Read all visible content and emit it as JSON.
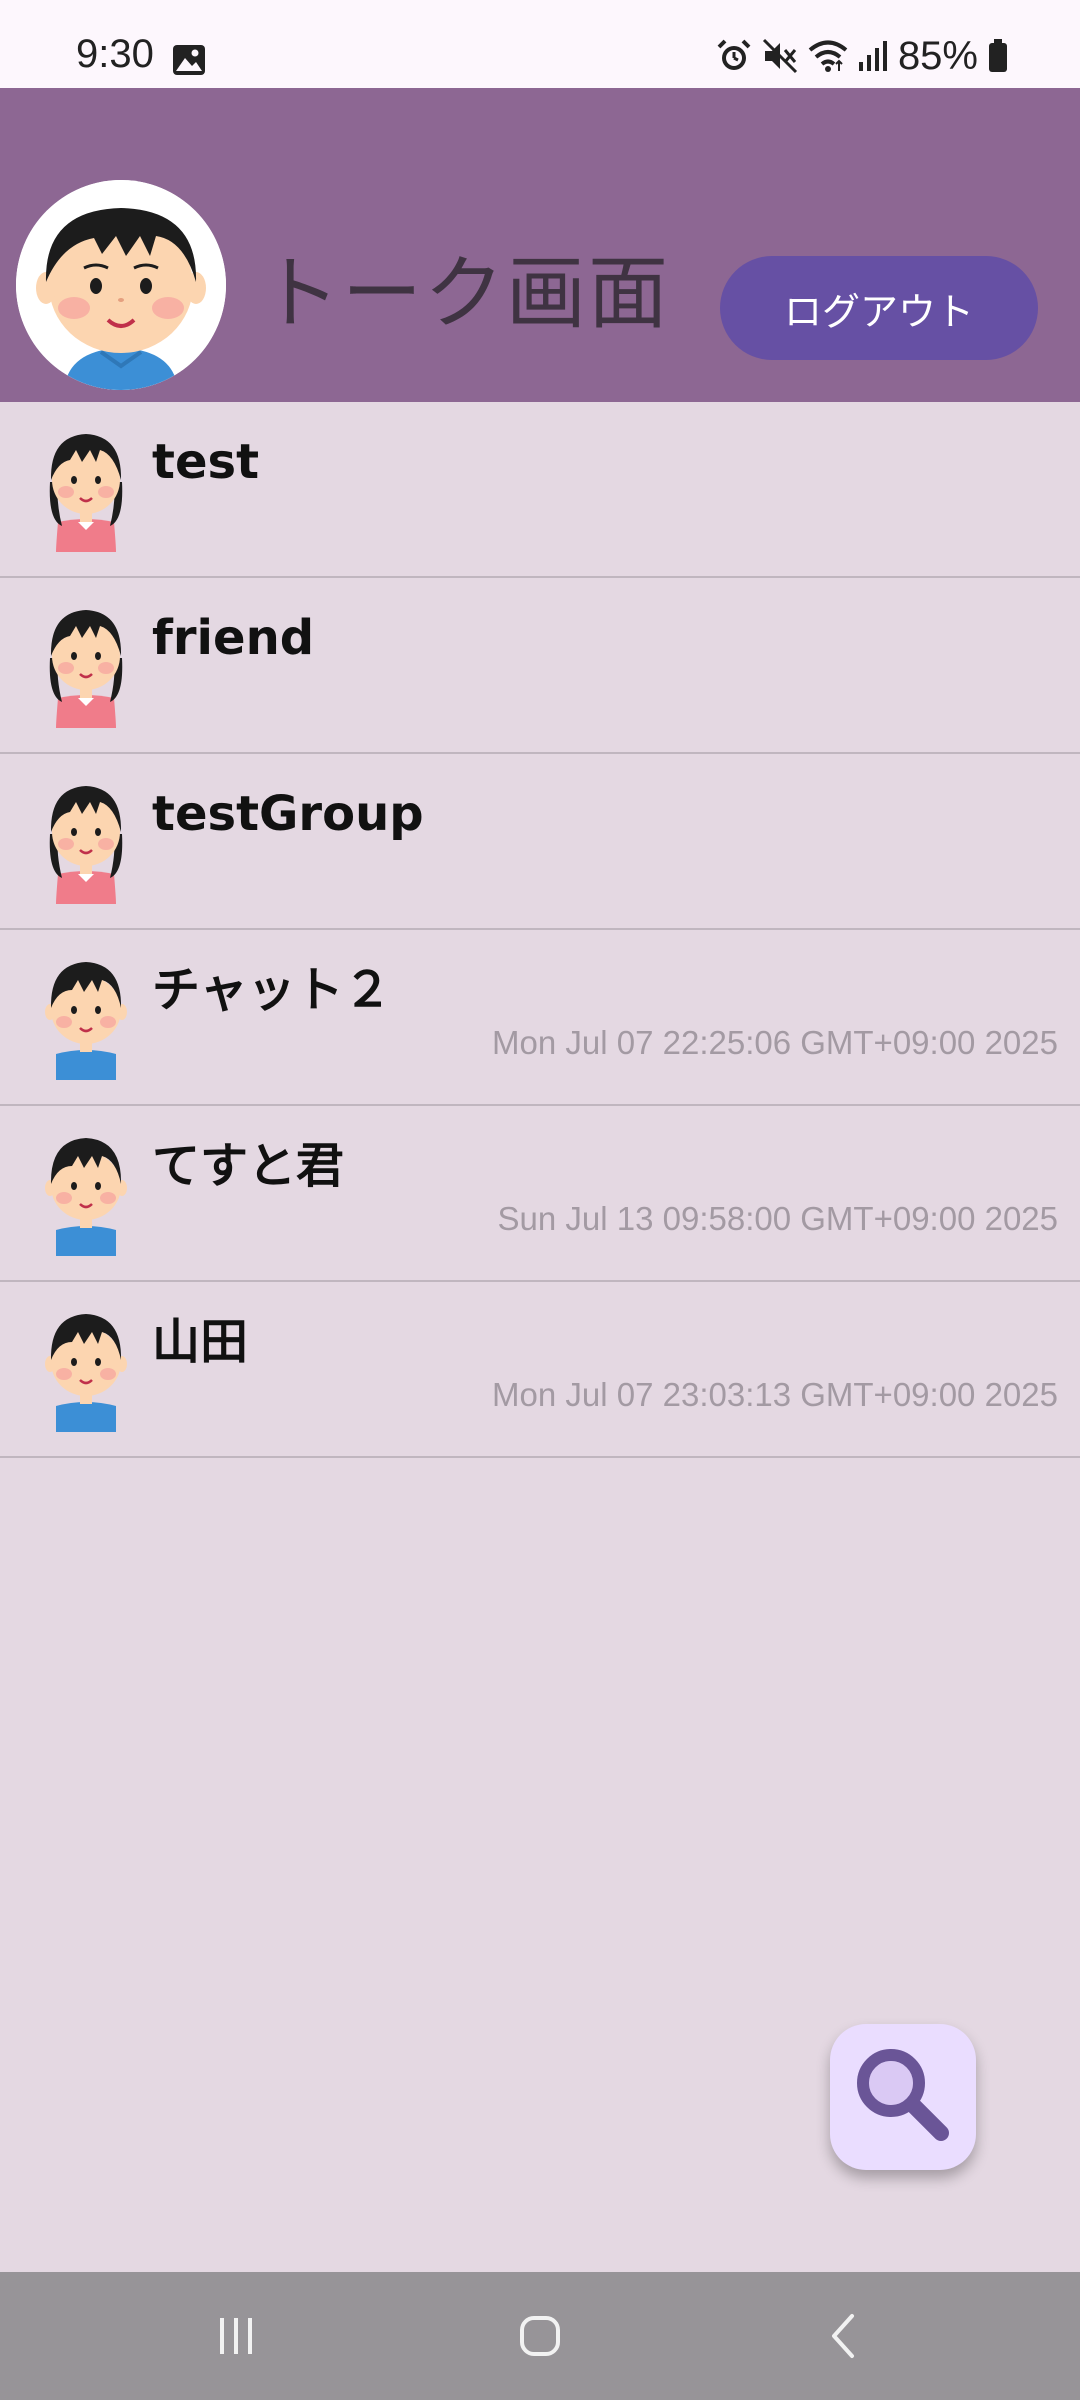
{
  "status_bar": {
    "time": "9:30",
    "battery_percent": "85%",
    "icons": [
      "image-icon",
      "alarm-icon",
      "mute-icon",
      "wifi-icon",
      "signal-icon",
      "battery-icon"
    ]
  },
  "header": {
    "title": "トーク画面",
    "logout_label": "ログアウト",
    "background_color": "#8d6793",
    "logout_color": "#6650a4"
  },
  "chats": [
    {
      "name": "test",
      "time": "",
      "avatar": "girl-avatar-icon"
    },
    {
      "name": "friend",
      "time": "",
      "avatar": "girl-avatar-icon"
    },
    {
      "name": "testGroup",
      "time": "",
      "avatar": "girl-avatar-icon"
    },
    {
      "name": "チャット２",
      "time": "Mon Jul 07 22:25:06 GMT+09:00 2025",
      "avatar": "boy-avatar-icon"
    },
    {
      "name": "てすと君",
      "time": "Sun Jul 13 09:58:00 GMT+09:00 2025",
      "avatar": "boy-avatar-icon"
    },
    {
      "name": "山田",
      "time": "Mon Jul 07 23:03:13 GMT+09:00 2025",
      "avatar": "boy-avatar-icon"
    }
  ],
  "fab": {
    "icon": "search-icon"
  },
  "nav_bar": {
    "buttons": [
      "recents-icon",
      "home-icon",
      "back-icon"
    ]
  }
}
